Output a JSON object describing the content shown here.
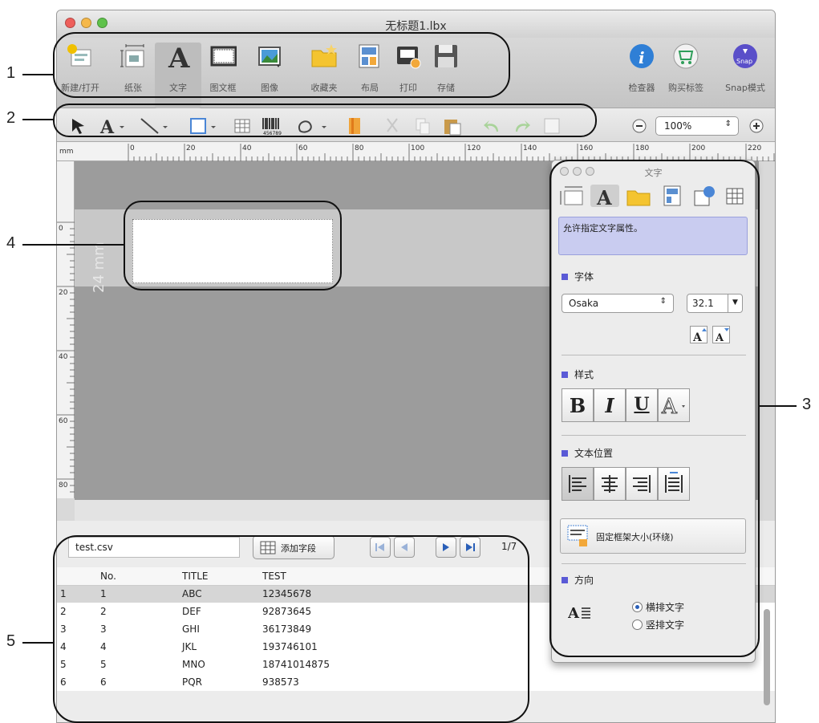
{
  "window": {
    "title": "无标题1.lbx"
  },
  "toolbar": {
    "items": [
      {
        "label": "新建/打开",
        "icon": "new-open-icon"
      },
      {
        "label": "纸张",
        "icon": "paper-icon"
      },
      {
        "label": "文字",
        "icon": "text-icon"
      },
      {
        "label": "图文框",
        "icon": "frame-icon"
      },
      {
        "label": "图像",
        "icon": "image-icon"
      },
      {
        "label": "收藏夹",
        "icon": "favorites-folder-icon"
      },
      {
        "label": "布局",
        "icon": "layout-icon"
      },
      {
        "label": "打印",
        "icon": "print-icon"
      },
      {
        "label": "存储",
        "icon": "save-disk-icon"
      }
    ],
    "right_items": [
      {
        "label": "检查器",
        "icon": "info-icon"
      },
      {
        "label": "购买标签",
        "icon": "shopping-cart-icon"
      },
      {
        "label": "Snap模式",
        "icon": "snap-icon"
      }
    ],
    "snap_badge": "Snap"
  },
  "toolbar2": {
    "zoom": "100%",
    "barcode_caption": "456789"
  },
  "ruler": {
    "unit": "mm",
    "h_ticks": [
      "0",
      "20",
      "40",
      "60",
      "80",
      "100",
      "120",
      "140",
      "160",
      "180",
      "200",
      "220"
    ],
    "v_ticks": [
      "0",
      "20",
      "40",
      "60",
      "80"
    ]
  },
  "canvas": {
    "tape_width": "24 mm"
  },
  "database": {
    "file": "test.csv",
    "add_field_label": "添加字段",
    "page": "1/7",
    "columns": [
      "",
      "No.",
      "TITLE",
      "TEST"
    ],
    "rows": [
      [
        "1",
        "1",
        "ABC",
        "12345678"
      ],
      [
        "2",
        "2",
        "DEF",
        "92873645"
      ],
      [
        "3",
        "3",
        "GHI",
        "36173849"
      ],
      [
        "4",
        "4",
        "JKL",
        "193746101"
      ],
      [
        "5",
        "5",
        "MNO",
        "18741014875"
      ],
      [
        "6",
        "6",
        "PQR",
        "938573"
      ]
    ]
  },
  "inspector": {
    "title": "文字",
    "description": "允许指定文字属性。",
    "font_section": "字体",
    "font_name": "Osaka",
    "font_size": "32.1",
    "style_section": "样式",
    "style_buttons": [
      "B",
      "I",
      "U"
    ],
    "position_section": "文本位置",
    "fixed_frame_label": "固定框架大小(环绕)",
    "direction_section": "方向",
    "horizontal_label": "横排文字",
    "vertical_label": "竖排文字",
    "selected_direction": "horizontal"
  },
  "callouts": [
    "1",
    "2",
    "3",
    "4",
    "5"
  ],
  "colors": {
    "accent": "#5a5ad6",
    "canvas": "#9c9c9c",
    "description_bg": "#c9ccf0"
  }
}
